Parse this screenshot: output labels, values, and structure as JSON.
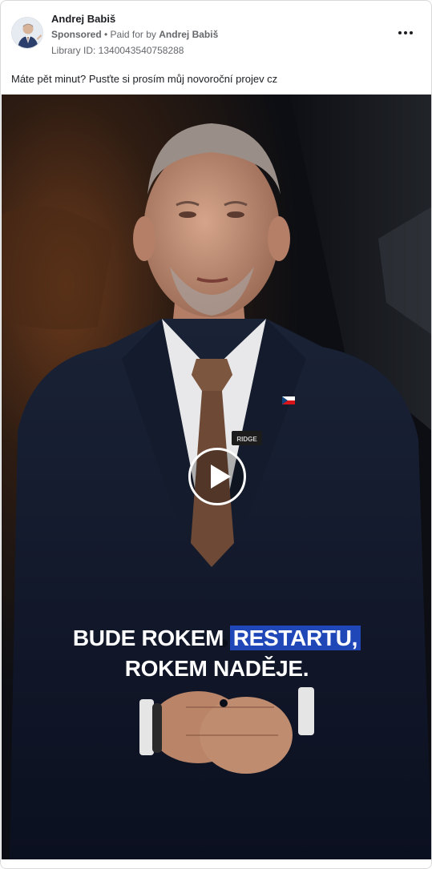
{
  "post": {
    "page_name": "Andrej Babiš",
    "sponsored_label": "Sponsored",
    "separator": " • ",
    "paid_for_prefix": "Paid for by ",
    "paid_for_name": "Andrej Babiš",
    "library_id": "Library ID: 1340043540758288",
    "ad_text": "Máte pět minut? Pusťte si prosím můj novoroční projev cz"
  },
  "video": {
    "caption_line1_a": "BUDE ROKEM ",
    "caption_line1_highlight": "RESTARTU,",
    "caption_line2": "ROKEM NADĚJE.",
    "mic_label": "RIDGE",
    "highlight_color": "#1f47b8"
  },
  "icons": {
    "more": "more-options-icon",
    "play": "play-icon",
    "flag_pin": "czech-flag-pin-icon"
  }
}
